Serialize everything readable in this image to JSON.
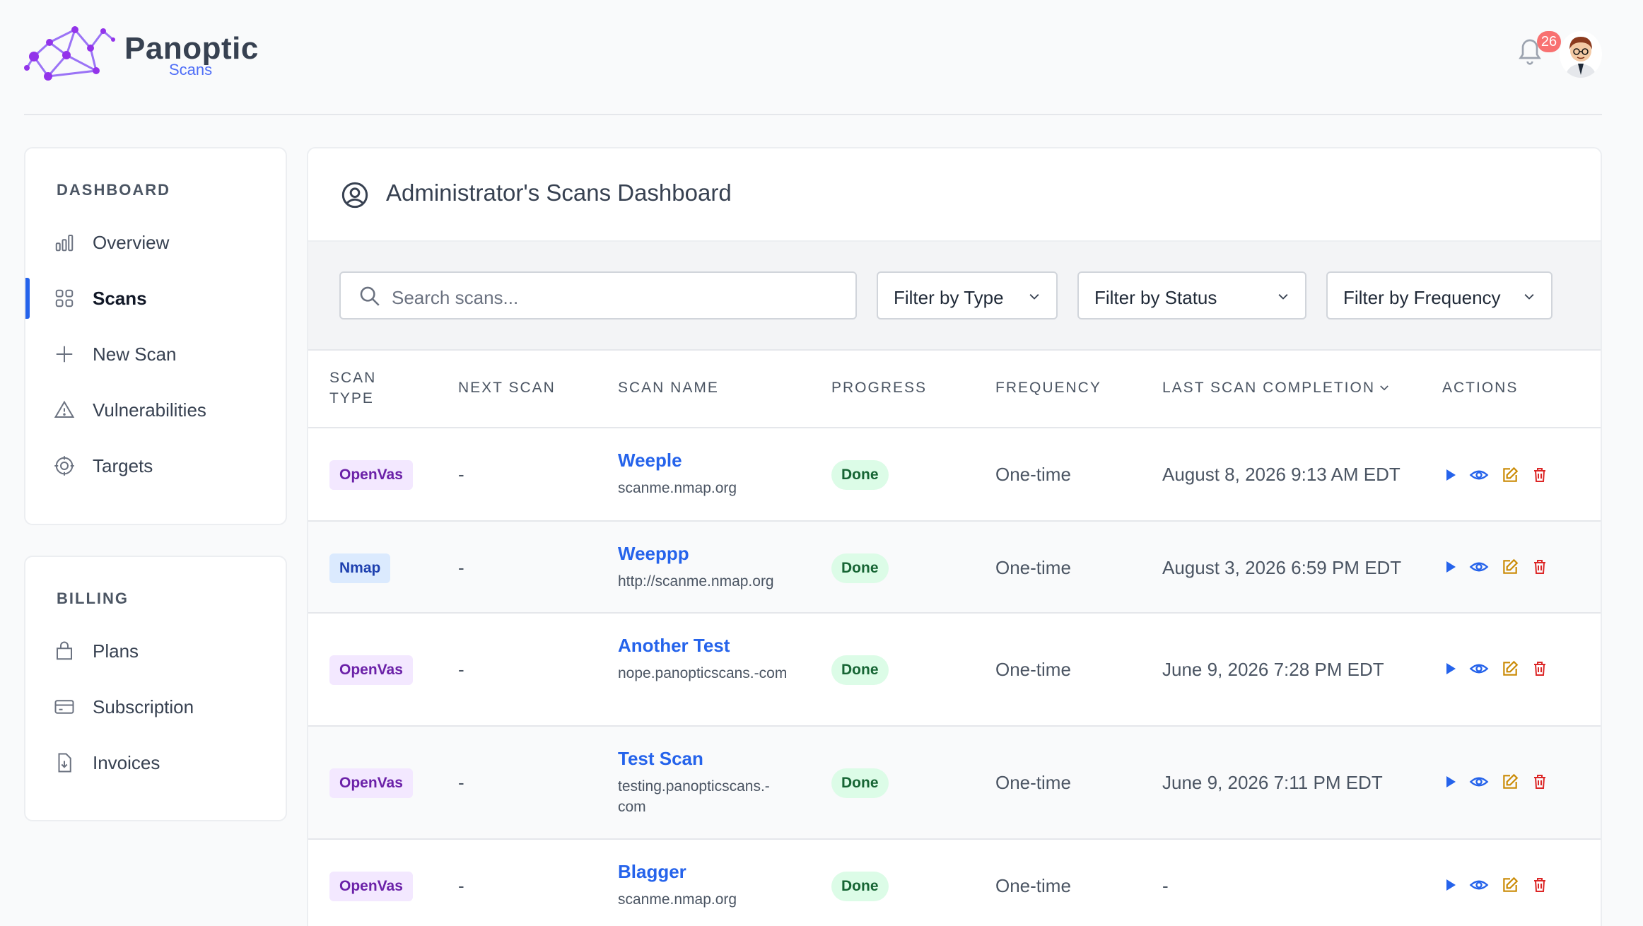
{
  "brand": {
    "name": "Panoptic",
    "sub": "Scans"
  },
  "notifications": {
    "count": "26"
  },
  "sidebar": {
    "dashboard_title": "DASHBOARD",
    "dashboard_items": [
      {
        "label": "Overview",
        "icon": "bar-chart-icon"
      },
      {
        "label": "Scans",
        "icon": "grid-icon",
        "active": true
      },
      {
        "label": "New Scan",
        "icon": "plus-icon"
      },
      {
        "label": "Vulnerabilities",
        "icon": "warning-icon"
      },
      {
        "label": "Targets",
        "icon": "target-icon"
      }
    ],
    "billing_title": "BILLING",
    "billing_items": [
      {
        "label": "Plans",
        "icon": "shopping-bag-icon"
      },
      {
        "label": "Subscription",
        "icon": "credit-card-icon"
      },
      {
        "label": "Invoices",
        "icon": "download-file-icon"
      }
    ]
  },
  "main": {
    "title": "Administrator's Scans Dashboard",
    "search_placeholder": "Search scans...",
    "filters": [
      "Filter by Type",
      "Filter by Status",
      "Filter by Frequency"
    ],
    "columns": {
      "scan_type": "SCAN TYPE",
      "next_scan": "NEXT SCAN",
      "scan_name": "SCAN NAME",
      "progress": "PROGRESS",
      "frequency": "FREQUENCY",
      "last_completion": "LAST SCAN COMPLETION",
      "actions": "ACTIONS"
    },
    "rows": [
      {
        "type": "OpenVas",
        "next": "-",
        "name": "Weeple",
        "target": "scanme.nmap.org",
        "progress": "Done",
        "frequency": "One-time",
        "last": "August 8, 2026 9:13 AM EDT"
      },
      {
        "type": "Nmap",
        "next": "-",
        "name": "Weeppp",
        "target": "http://scanme.nmap.org",
        "progress": "Done",
        "frequency": "One-time",
        "last": "August 3, 2026 6:59 PM EDT"
      },
      {
        "type": "OpenVas",
        "next": "-",
        "name": "Another Test",
        "target": "nope.panopticscans.-com",
        "progress": "Done",
        "frequency": "One-time",
        "last": "June 9, 2026 7:28 PM EDT"
      },
      {
        "type": "OpenVas",
        "next": "-",
        "name": "Test Scan",
        "target": "testing.panopticscans.-com",
        "progress": "Done",
        "frequency": "One-time",
        "last": "June 9, 2026 7:11 PM EDT"
      },
      {
        "type": "OpenVas",
        "next": "-",
        "name": "Blagger",
        "target": "scanme.nmap.org",
        "progress": "Done",
        "frequency": "One-time",
        "last": "-"
      }
    ]
  },
  "colors": {
    "accent": "#2563eb",
    "openvas_bg": "#f3e8ff",
    "nmap_bg": "#dbeafe",
    "done_bg": "#dcfce7"
  }
}
